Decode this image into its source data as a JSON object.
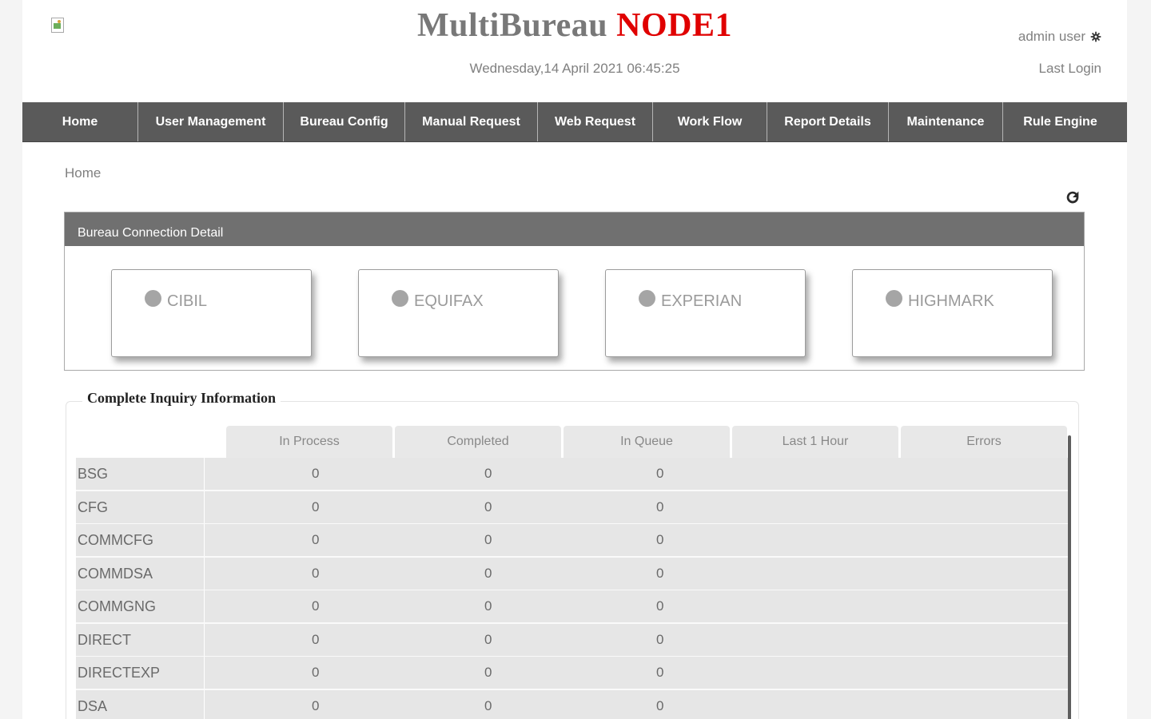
{
  "header": {
    "brand_part1": "MultiBureau",
    "brand_part2": "NODE1",
    "datetime": "Wednesday,14 April 2021 06:45:25",
    "user_name": "admin user",
    "last_login_label": "Last Login"
  },
  "nav": {
    "items": [
      {
        "label": "Home"
      },
      {
        "label": "User Management"
      },
      {
        "label": "Bureau Config"
      },
      {
        "label": "Manual Request"
      },
      {
        "label": "Web Request"
      },
      {
        "label": "Work Flow"
      },
      {
        "label": "Report Details"
      },
      {
        "label": "Maintenance"
      },
      {
        "label": "Rule Engine"
      }
    ]
  },
  "breadcrumb": "Home",
  "bureau_panel": {
    "title": "Bureau Connection Detail",
    "bureaus": [
      {
        "name": "CIBIL",
        "status_color": "#a5a5a5"
      },
      {
        "name": "EQUIFAX",
        "status_color": "#a5a5a5"
      },
      {
        "name": "EXPERIAN",
        "status_color": "#a5a5a5"
      },
      {
        "name": "HIGHMARK",
        "status_color": "#a5a5a5"
      }
    ]
  },
  "inquiry": {
    "title": "Complete Inquiry Information",
    "columns": [
      "In Process",
      "Completed",
      "In Queue",
      "Last 1 Hour",
      "Errors"
    ],
    "rows": [
      {
        "name": "BSG",
        "in_process": "0",
        "completed": "0",
        "in_queue": "0"
      },
      {
        "name": "CFG",
        "in_process": "0",
        "completed": "0",
        "in_queue": "0"
      },
      {
        "name": "COMMCFG",
        "in_process": "0",
        "completed": "0",
        "in_queue": "0"
      },
      {
        "name": "COMMDSA",
        "in_process": "0",
        "completed": "0",
        "in_queue": "0"
      },
      {
        "name": "COMMGNG",
        "in_process": "0",
        "completed": "0",
        "in_queue": "0"
      },
      {
        "name": "DIRECT",
        "in_process": "0",
        "completed": "0",
        "in_queue": "0"
      },
      {
        "name": "DIRECTEXP",
        "in_process": "0",
        "completed": "0",
        "in_queue": "0"
      },
      {
        "name": "DSA",
        "in_process": "0",
        "completed": "0",
        "in_queue": "0"
      }
    ]
  },
  "icons": {
    "logo": "broken-image-icon",
    "settings": "gear-icon",
    "refresh": "refresh-icon"
  }
}
